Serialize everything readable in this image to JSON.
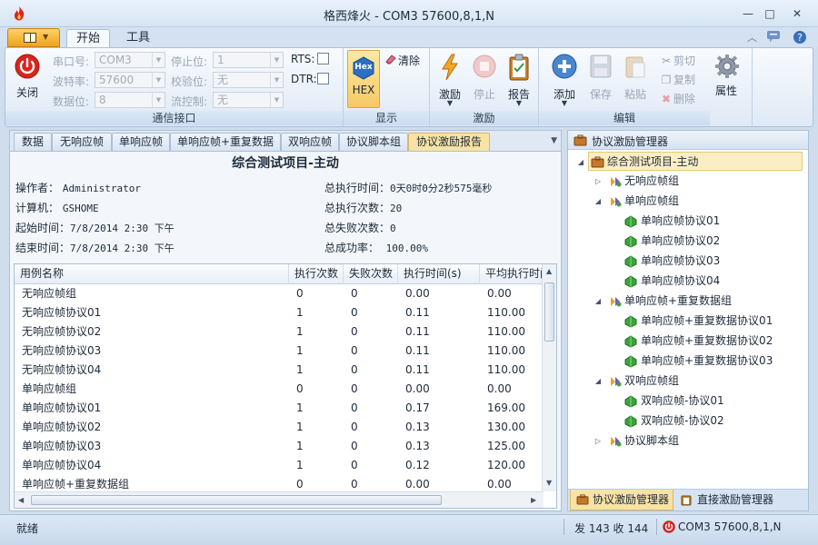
{
  "window": {
    "title": "格西烽火 - COM3  57600,8,1,N",
    "min": "—",
    "max": "□",
    "close": "✕"
  },
  "ribbon_tabs": {
    "home": "开始",
    "tools": "工具"
  },
  "ribbon": {
    "comm": {
      "close_label": "关闭",
      "port_label": "串口号:",
      "port_value": "COM3",
      "baud_label": "波特率:",
      "baud_value": "57600",
      "databits_label": "数据位:",
      "databits_value": "8",
      "stopbits_label": "停止位:",
      "stopbits_value": "1",
      "parity_label": "校验位:",
      "parity_value": "无",
      "flow_label": "流控制:",
      "flow_value": "无",
      "rts_label": "RTS:",
      "dtr_label": "DTR:",
      "group_label": "通信接口"
    },
    "display": {
      "hex_label": "HEX",
      "hex_icon_text": "Hex",
      "clear_label": "清除",
      "group_label": "显示"
    },
    "stimulus": {
      "stimulus_label": "激励",
      "stop_label": "停止",
      "report_label": "报告",
      "group_label": "激励"
    },
    "edit": {
      "add_label": "添加",
      "save_label": "保存",
      "paste_label": "粘贴",
      "cut_label": "剪切",
      "copy_label": "复制",
      "delete_label": "删除",
      "group_label": "编辑"
    },
    "properties_label": "属性"
  },
  "doc_tabs": [
    "数据",
    "无响应帧",
    "单响应帧",
    "单响应帧+重复数据",
    "双响应帧",
    "协议脚本组",
    "协议激励报告"
  ],
  "report": {
    "title": "综合测试项目-主动",
    "operator_label": "操作者：",
    "operator_value": "Administrator",
    "computer_label": "计算机：",
    "computer_value": "GSHOME",
    "start_label": "起始时间：",
    "start_value": "7/8/2014 2:30 下午",
    "end_label": "结束时间：",
    "end_value": "7/8/2014 2:30 下午",
    "total_time_label": "总执行时间：",
    "total_time_value": "0天0时0分2秒575毫秒",
    "total_runs_label": "总执行次数：",
    "total_runs_value": "20",
    "total_fail_label": "总失败次数：",
    "total_fail_value": "0",
    "success_label": "总成功率：",
    "success_value": "100.00%"
  },
  "grid": {
    "columns": [
      "用例名称",
      "执行次数",
      "失败次数",
      "执行时间(s)",
      "平均执行时间"
    ],
    "rows": [
      [
        "无响应帧组",
        "0",
        "0",
        "0.00",
        "0.00"
      ],
      [
        "无响应帧协议01",
        "1",
        "0",
        "0.11",
        "110.00"
      ],
      [
        "无响应帧协议02",
        "1",
        "0",
        "0.11",
        "110.00"
      ],
      [
        "无响应帧协议03",
        "1",
        "0",
        "0.11",
        "110.00"
      ],
      [
        "无响应帧协议04",
        "1",
        "0",
        "0.11",
        "110.00"
      ],
      [
        "单响应帧组",
        "0",
        "0",
        "0.00",
        "0.00"
      ],
      [
        "单响应帧协议01",
        "1",
        "0",
        "0.17",
        "169.00"
      ],
      [
        "单响应帧协议02",
        "1",
        "0",
        "0.13",
        "130.00"
      ],
      [
        "单响应帧协议03",
        "1",
        "0",
        "0.13",
        "125.00"
      ],
      [
        "单响应帧协议04",
        "1",
        "0",
        "0.12",
        "120.00"
      ],
      [
        "单响应帧+重复数据组",
        "0",
        "0",
        "0.00",
        "0.00"
      ]
    ]
  },
  "manager": {
    "title": "协议激励管理器",
    "tree": [
      {
        "label": "综合测试项目-主动",
        "level": 0,
        "expander": "◢",
        "kind": "project",
        "selected": true
      },
      {
        "label": "无响应帧组",
        "level": 1,
        "expander": "▷",
        "kind": "group"
      },
      {
        "label": "单响应帧组",
        "level": 1,
        "expander": "◢",
        "kind": "group"
      },
      {
        "label": "单响应帧协议01",
        "level": 2,
        "expander": "",
        "kind": "item"
      },
      {
        "label": "单响应帧协议02",
        "level": 2,
        "expander": "",
        "kind": "item"
      },
      {
        "label": "单响应帧协议03",
        "level": 2,
        "expander": "",
        "kind": "item"
      },
      {
        "label": "单响应帧协议04",
        "level": 2,
        "expander": "",
        "kind": "item"
      },
      {
        "label": "单响应帧+重复数据组",
        "level": 1,
        "expander": "◢",
        "kind": "group"
      },
      {
        "label": "单响应帧+重复数据协议01",
        "level": 2,
        "expander": "",
        "kind": "item"
      },
      {
        "label": "单响应帧+重复数据协议02",
        "level": 2,
        "expander": "",
        "kind": "item"
      },
      {
        "label": "单响应帧+重复数据协议03",
        "level": 2,
        "expander": "",
        "kind": "item"
      },
      {
        "label": "双响应帧组",
        "level": 1,
        "expander": "◢",
        "kind": "group"
      },
      {
        "label": "双响应帧-协议01",
        "level": 2,
        "expander": "",
        "kind": "item"
      },
      {
        "label": "双响应帧-协议02",
        "level": 2,
        "expander": "",
        "kind": "item"
      },
      {
        "label": "协议脚本组",
        "level": 1,
        "expander": "▷",
        "kind": "group"
      }
    ],
    "bottom_tabs": [
      "协议激励管理器",
      "直接激励管理器"
    ]
  },
  "status": {
    "text": "就绪",
    "counts": "发 143  收 144",
    "port": "COM3  57600,8,1,N"
  },
  "colors": {
    "accent": "#f0a21d",
    "selected_tab": "#f8e3a4",
    "close_red": "#d9251c",
    "gem_green": "#3aa53a"
  }
}
